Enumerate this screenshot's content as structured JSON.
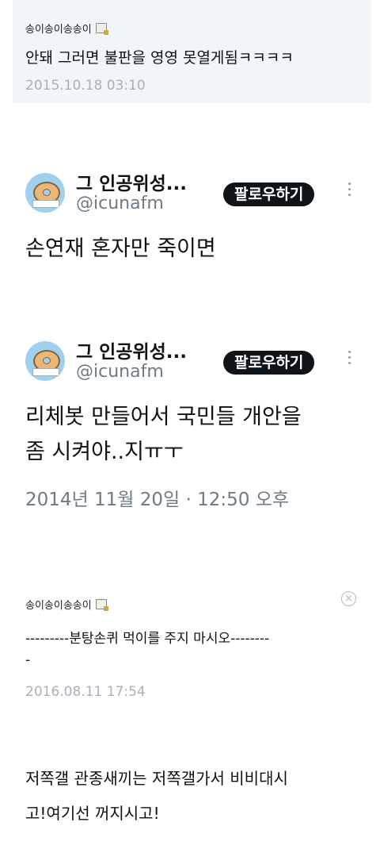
{
  "comment1": {
    "nickname": "송이송이송송이",
    "text": "안돼 그러면 불판을 영영 못열게됨ㅋㅋㅋㅋ",
    "timestamp": "2015.10.18 03:10"
  },
  "tweet1": {
    "name": "그 인공위성...",
    "handle": "@icunafm",
    "follow_label": "팔로우하기",
    "text": "손연재 혼자만 죽이면"
  },
  "tweet2": {
    "name": "그 인공위성...",
    "handle": "@icunafm",
    "follow_label": "팔로우하기",
    "text_line1": "리체봇 만들어서 국민들 개안을",
    "text_line2": "좀 시켜야..지ㅠㅜ",
    "time": "2014년 11월 20일 · 12:50 오후"
  },
  "comment2": {
    "nickname": "송이송이송송이",
    "text_line1": "---------분탕손퀴 먹이를 주지 마시오--------",
    "text_line2": "-",
    "timestamp": "2016.08.11 17:54",
    "close_glyph": "×"
  },
  "footer": {
    "line1": "저쪽갤 관종새끼는 저쪽갤가서 비비대시",
    "line2": "고!여기선 꺼지시고!"
  }
}
